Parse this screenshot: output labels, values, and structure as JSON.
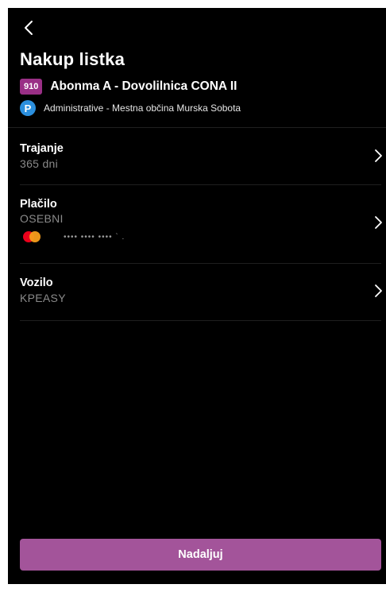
{
  "header": {
    "back_icon": "chevron-left-icon",
    "title": "Nakup listka"
  },
  "ticket": {
    "badge": "910",
    "badge_color": "#9a2f86",
    "name": "Abonma A - Dovolilnica CONA II"
  },
  "zone": {
    "icon": "parking-icon",
    "icon_letter": "P",
    "icon_color": "#2b8fde",
    "name": "Administrative - Mestna občina Murska Sobota"
  },
  "options": {
    "duration": {
      "label": "Trajanje",
      "value": "365 dni"
    },
    "payment": {
      "label": "Plačilo",
      "value": "OSEBNI",
      "card_icon": "mastercard-icon",
      "card_number": "•••• •••• •••• ` ."
    },
    "vehicle": {
      "label": "Vozilo",
      "value": "KPEASY"
    },
    "chevron_icon": "chevron-right-icon"
  },
  "footer": {
    "continue_label": "Nadaljuj",
    "button_color": "#a3549a"
  }
}
